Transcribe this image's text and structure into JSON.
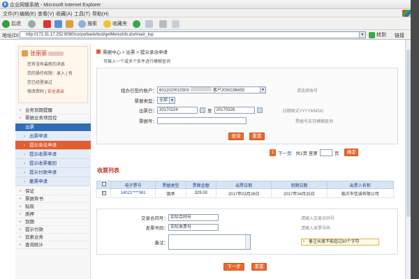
{
  "window": {
    "title": "企业网银系统 - Microsoft Internet Explorer"
  },
  "menu": [
    "文件(F)",
    "编辑(E)",
    "查看(V)",
    "收藏(A)",
    "工具(T)",
    "帮助(H)"
  ],
  "toolbar": {
    "back": "后退",
    "search": "搜索",
    "favorites": "收藏夹"
  },
  "address": {
    "label": "地址(D)",
    "url": "http://172.31.17.252:9080/corporbank/test/getMenuInfo.do#main_top",
    "go": "转到",
    "links": "链接"
  },
  "user": {
    "name": "张丽丽",
    "lines": [
      "您有没有最新的消息",
      "您的操作权限：录入 | 有",
      "您已经登录过",
      "修改密码 | 安全退出"
    ],
    "status": "安全退出"
  },
  "nav": {
    "top_items": [
      "业务到期提醒",
      "票据业务项目控"
    ],
    "section": "出票",
    "sub_items": [
      "出票申请",
      "提示承兑申请",
      "提示收票申请",
      "提示收票撤回",
      "提示付款申请",
      "撤票申请"
    ],
    "active": "提示承兑申请",
    "bottom_items": [
      "保证",
      "票据背书",
      "贴现",
      "质押",
      "到期",
      "提示付款",
      "追索业务",
      "查询统计"
    ]
  },
  "breadcrumb": "票据中心 > 出票 > 提示承兑申请",
  "hint": "可输入一个或多个条件进行模糊查询",
  "query": {
    "account_label": "组办已签约账户：",
    "account_value": "6011020010300",
    "account_suffix": "客户2050196455",
    "account_tip": "请选择账号",
    "type_label": "票据类型：",
    "type_value": "全部",
    "date_label": "出票日：",
    "date_from": "20170224",
    "date_sep": "至",
    "date_to": "20170326",
    "date_tip": "日期格式YYYYMMDD",
    "no_label": "票据号：",
    "no_value": "",
    "no_tip": "票据号支持模糊查询",
    "query_btn": "查询",
    "reset_btn": "重置"
  },
  "pager": {
    "prev": "1",
    "next": "下一页",
    "total": "共1页 至第",
    "page_unit": "页",
    "go": "确定"
  },
  "result": {
    "title": "收票列表",
    "headers": [
      "",
      "电子票号",
      "票据类型",
      "票面金额",
      "出票日期",
      "到期日期",
      "出票人名称"
    ],
    "rows": [
      [
        "",
        "14021****361",
        "银承",
        "329.00",
        "2017年03月26日",
        "2017年04月25日",
        "临沂市信诚有限公司"
      ]
    ]
  },
  "form": {
    "contract_label": "交易合同号：",
    "contract_value": "实际合同号",
    "contract_tip": "请输入交易合同号",
    "invoice_label": "发票号码：",
    "invoice_value": "实际发票号",
    "invoice_tip": "请输入发票号码",
    "remark_label": "备注：",
    "remark_note": "备注长度不能超过60个字符",
    "next_btn": "下一步",
    "reset_btn": "重置"
  }
}
